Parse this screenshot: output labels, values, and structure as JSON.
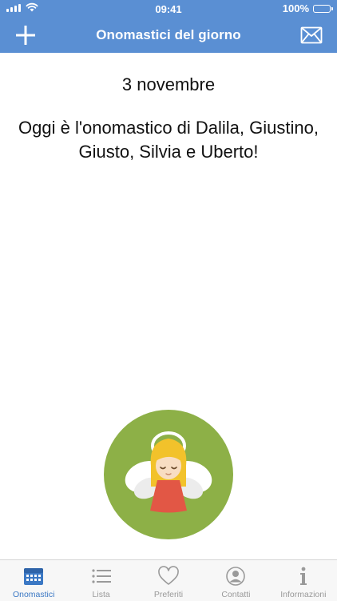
{
  "status_bar": {
    "time": "09:41",
    "battery": "100%"
  },
  "nav": {
    "title": "Onomastici del giorno",
    "left_icon": "plus-icon",
    "right_icon": "mail-icon"
  },
  "content": {
    "date": "3 novembre",
    "message": "Oggi è l'onomastico di Dalila, Giustino, Giusto, Silvia e Uberto!"
  },
  "illustration": {
    "icon": "angel-icon",
    "background_color": "#8db047"
  },
  "tabs": [
    {
      "label": "Onomastici",
      "icon": "calendar-icon",
      "active": true
    },
    {
      "label": "Lista",
      "icon": "list-icon",
      "active": false
    },
    {
      "label": "Preferiti",
      "icon": "heart-icon",
      "active": false
    },
    {
      "label": "Contatti",
      "icon": "contact-icon",
      "active": false
    },
    {
      "label": "Informazioni",
      "icon": "info-icon",
      "active": false
    }
  ],
  "colors": {
    "header": "#5a8fd3",
    "tab_active": "#3b78c4",
    "tab_inactive": "#9a9a9a"
  }
}
